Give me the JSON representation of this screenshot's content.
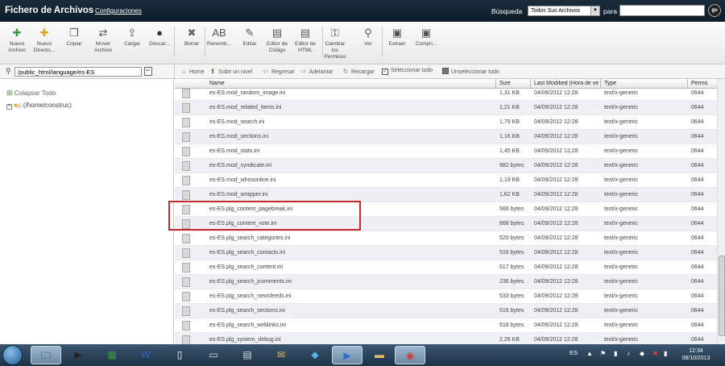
{
  "header": {
    "title": "Fichero de Archivos",
    "config_link": "Configuraciones",
    "search_label": "Búsqueda",
    "search_select": "Todos Sus Archivos",
    "para_label": "para",
    "search_value": "",
    "go_label": "go"
  },
  "toolbar": {
    "items": [
      {
        "label": "Nuevo Archivo",
        "icon": "new-file-icon"
      },
      {
        "label": "Nuevo Directo...",
        "icon": "new-folder-icon"
      },
      {
        "label": "Copiar",
        "icon": "copy-icon"
      },
      {
        "label": "Mover Archivo",
        "icon": "move-icon"
      },
      {
        "label": "Cargar",
        "icon": "upload-icon"
      },
      {
        "label": "Descar...",
        "icon": "download-icon"
      },
      {
        "label": "Borrar",
        "icon": "delete-icon"
      },
      {
        "label": "Renomb...",
        "icon": "rename-icon"
      },
      {
        "label": "Editar",
        "icon": "edit-icon"
      },
      {
        "label": "Editor de Código",
        "icon": "code-editor-icon"
      },
      {
        "label": "Editor de HTML",
        "icon": "html-editor-icon"
      },
      {
        "label": "Cambiar los Permisos",
        "icon": "permissions-icon"
      },
      {
        "label": "Ver",
        "icon": "view-icon"
      },
      {
        "label": "Extraer",
        "icon": "extract-icon"
      },
      {
        "label": "Compri...",
        "icon": "compress-icon"
      }
    ]
  },
  "pathbar": {
    "path": "/public_html/language/es-ES"
  },
  "nav": {
    "home": "Home",
    "up": "Subir un nivel",
    "back": "Regresar",
    "forward": "Adelantar",
    "reload": "Recargar",
    "select_all": "Seleccionar todo",
    "unselect_all": "Unseleccionar todo"
  },
  "sidebar": {
    "collapse": "Colapsar Todo",
    "tree_root": "(/home/construc)"
  },
  "table": {
    "columns": {
      "name": "Name",
      "size": "Size",
      "modified": "Last Modified (Hora de ve",
      "type": "Type",
      "perms": "Perms"
    },
    "rows": [
      {
        "name": "es-ES.mod_random_image.ini",
        "size": "1,31 KB",
        "modified": "04/09/2012 12:28",
        "type": "text/x-generic",
        "perms": "0644"
      },
      {
        "name": "es-ES.mod_related_items.ini",
        "size": "1,21 KB",
        "modified": "04/09/2012 12:28",
        "type": "text/x-generic",
        "perms": "0644"
      },
      {
        "name": "es-ES.mod_search.ini",
        "size": "1,79 KB",
        "modified": "04/09/2012 12:28",
        "type": "text/x-generic",
        "perms": "0644"
      },
      {
        "name": "es-ES.mod_sections.ini",
        "size": "1,16 KB",
        "modified": "04/09/2012 12:28",
        "type": "text/x-generic",
        "perms": "0644"
      },
      {
        "name": "es-ES.mod_stats.ini",
        "size": "1,45 KB",
        "modified": "04/09/2012 12:28",
        "type": "text/x-generic",
        "perms": "0644"
      },
      {
        "name": "es-ES.mod_syndicate.ini",
        "size": "982 bytes",
        "modified": "04/09/2012 12:28",
        "type": "text/x-generic",
        "perms": "0644"
      },
      {
        "name": "es-ES.mod_whosonline.ini",
        "size": "1,19 KB",
        "modified": "04/09/2012 12:28",
        "type": "text/x-generic",
        "perms": "0644"
      },
      {
        "name": "es-ES.mod_wrapper.ini",
        "size": "1,62 KB",
        "modified": "04/09/2012 12:28",
        "type": "text/x-generic",
        "perms": "0644"
      },
      {
        "name": "es-ES.plg_content_pagebreak.ini",
        "size": "566 bytes",
        "modified": "04/09/2012 12:28",
        "type": "text/x-generic",
        "perms": "0644"
      },
      {
        "name": "es-ES.plg_content_vote.ini",
        "size": "668 bytes",
        "modified": "04/09/2012 12:28",
        "type": "text/x-generic",
        "perms": "0644"
      },
      {
        "name": "es-ES.plg_search_categories.ini",
        "size": "520 bytes",
        "modified": "04/09/2012 12:28",
        "type": "text/x-generic",
        "perms": "0644"
      },
      {
        "name": "es-ES.plg_search_contacts.ini",
        "size": "516 bytes",
        "modified": "04/09/2012 12:28",
        "type": "text/x-generic",
        "perms": "0644"
      },
      {
        "name": "es-ES.plg_search_content.ini",
        "size": "517 bytes",
        "modified": "04/09/2012 12:28",
        "type": "text/x-generic",
        "perms": "0644"
      },
      {
        "name": "es-ES.plg_search_jcomments.ini",
        "size": "236 bytes",
        "modified": "04/09/2012 12:28",
        "type": "text/x-generic",
        "perms": "0644"
      },
      {
        "name": "es-ES.plg_search_newsfeeds.ini",
        "size": "533 bytes",
        "modified": "04/09/2012 12:28",
        "type": "text/x-generic",
        "perms": "0644"
      },
      {
        "name": "es-ES.plg_search_sections.ini",
        "size": "516 bytes",
        "modified": "04/09/2012 12:28",
        "type": "text/x-generic",
        "perms": "0644"
      },
      {
        "name": "es-ES.plg_search_weblinks.ini",
        "size": "518 bytes",
        "modified": "04/09/2012 12:28",
        "type": "text/x-generic",
        "perms": "0644"
      },
      {
        "name": "es-ES.plg_system_debug.ini",
        "size": "2,26 KB",
        "modified": "04/09/2012 12:28",
        "type": "text/x-generic",
        "perms": "0644"
      }
    ]
  },
  "taskbar": {
    "lang": "ES",
    "time": "12:34",
    "date": "08/10/2013"
  },
  "colors": {
    "topbar": "#15283a",
    "highlight": "#c8282e",
    "row_alt": "#eef0f6"
  }
}
